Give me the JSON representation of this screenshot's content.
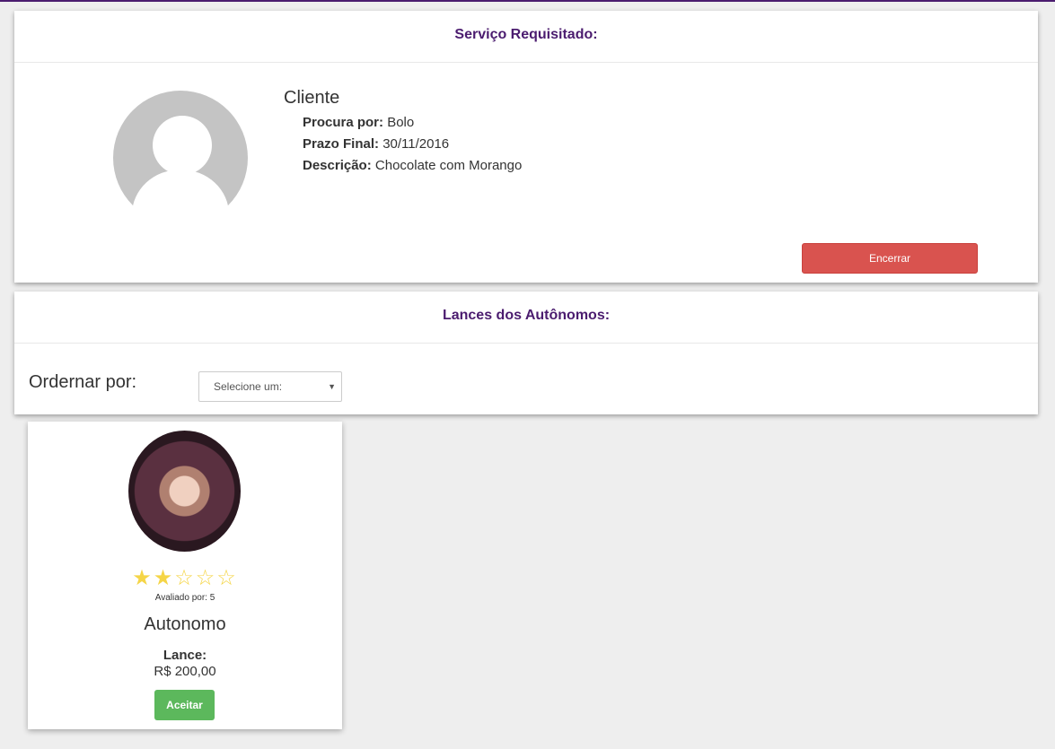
{
  "service": {
    "title": "Serviço Requisitado:",
    "client_name": "Cliente",
    "fields": [
      {
        "label": "Procura por:",
        "value": "Bolo"
      },
      {
        "label": "Prazo Final:",
        "value": "30/11/2016"
      },
      {
        "label": "Descrição:",
        "value": "Chocolate com Morango"
      }
    ],
    "close_button": "Encerrar"
  },
  "bids": {
    "title": "Lances dos Autônomos:",
    "sort_label": "Ordernar por:",
    "sort_select": "Selecione um:"
  },
  "card": {
    "rating": 2,
    "rating_max": 5,
    "stars": "★★☆☆☆",
    "rated_by": "Avaliado por: 5",
    "name": "Autonomo",
    "bid_label": "Lance:",
    "bid_value": "R$ 200,00",
    "accept_button": "Aceitar"
  }
}
